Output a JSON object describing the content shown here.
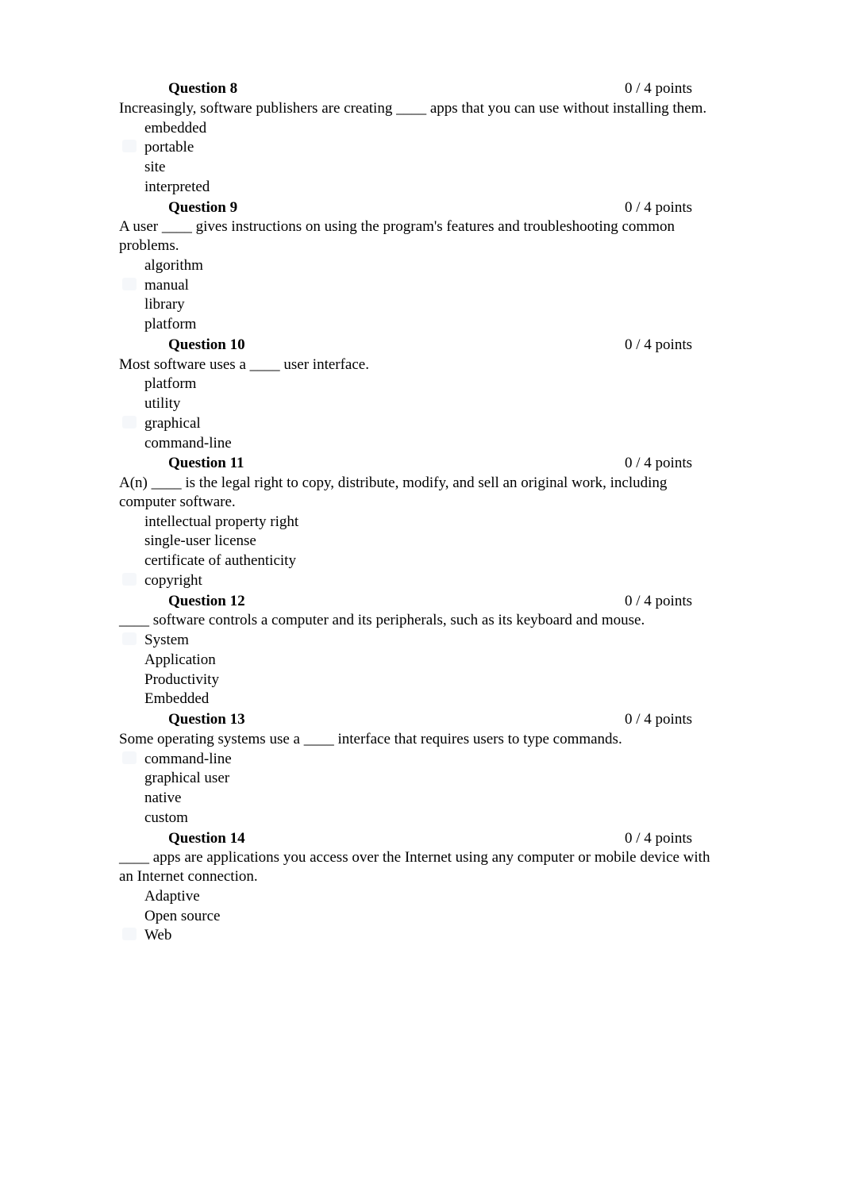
{
  "questions": [
    {
      "label": "Question 8",
      "points": "0 / 4 points",
      "text": "Increasingly, software publishers are creating ____ apps that you can use without installing them.",
      "options": [
        "embedded",
        "portable",
        "site",
        "interpreted"
      ]
    },
    {
      "label": "Question 9",
      "points": "0 / 4 points",
      "text": "A user ____ gives instructions on using the program's features and troubleshooting common problems.",
      "options": [
        "algorithm",
        "manual",
        "library",
        "platform"
      ]
    },
    {
      "label": "Question 10",
      "points": "0 / 4 points",
      "text": "Most software uses a ____ user interface.",
      "options": [
        "platform",
        "utility",
        "graphical",
        "command-line"
      ]
    },
    {
      "label": "Question 11",
      "points": "0 / 4 points",
      "text": "A(n) ____ is the legal right to copy, distribute, modify, and sell an original work, including computer software.",
      "options": [
        "intellectual property right",
        "single-user license",
        "certificate of authenticity",
        "copyright"
      ]
    },
    {
      "label": "Question 12",
      "points": "0 / 4 points",
      "text": "____ software controls a computer and its peripherals, such as its keyboard and mouse.",
      "options": [
        "System",
        "Application",
        "Productivity",
        "Embedded"
      ]
    },
    {
      "label": "Question 13",
      "points": "0 / 4 points",
      "text": "Some operating systems use a ____ interface that requires users to type commands.",
      "options": [
        "command-line",
        "graphical user",
        "native",
        "custom"
      ]
    },
    {
      "label": "Question 14",
      "points": "0 / 4 points",
      "text": "____ apps are applications you access over the Internet using any computer or mobile device with an Internet connection.",
      "options": [
        "Adaptive",
        "Open source",
        "Web"
      ]
    }
  ]
}
